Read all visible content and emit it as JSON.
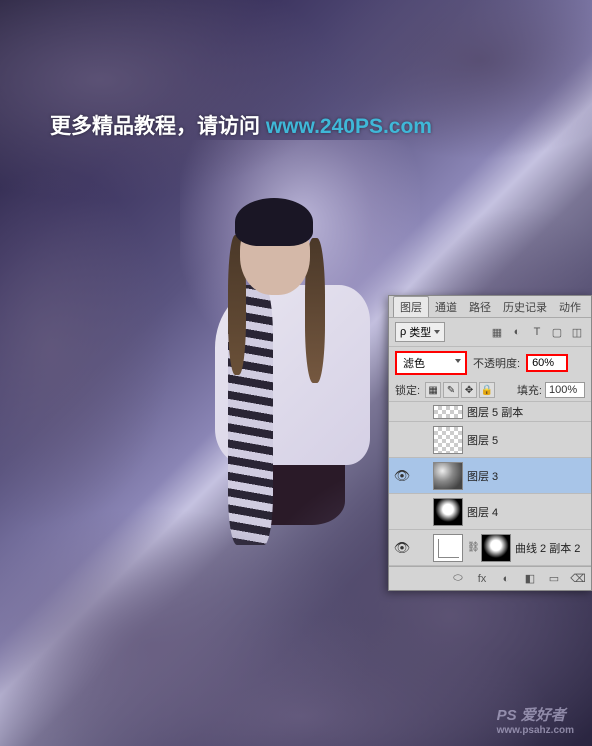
{
  "banner": {
    "text_prefix": "更多精品教程，请访问 ",
    "url": "www.240PS.com"
  },
  "watermark": {
    "logo": "PS 爱好者",
    "url": "www.psahz.com"
  },
  "panel": {
    "tabs": {
      "layers": "图层",
      "channels": "通道",
      "paths": "路径",
      "history": "历史记录",
      "actions": "动作"
    },
    "type_filter": {
      "search_icon": "ρ",
      "label": "类型",
      "icons": [
        "▦",
        "◐",
        "T",
        "▢",
        "◫"
      ]
    },
    "blend": {
      "mode": "滤色",
      "opacity_label": "不透明度:",
      "opacity_value": "60%"
    },
    "lock": {
      "label": "锁定:",
      "icons": [
        "▦",
        "✎",
        "✥",
        "🔒"
      ],
      "fill_label": "填充:",
      "fill_value": "100%"
    },
    "layers": [
      {
        "visible": false,
        "name": "图层 5 副本",
        "thumb": "hidden-partial",
        "partial": true
      },
      {
        "visible": false,
        "name": "图层 5",
        "thumb": "checker",
        "selected": false,
        "indent": true
      },
      {
        "visible": true,
        "name": "图层 3",
        "thumb": "cloud",
        "selected": true,
        "indent": true
      },
      {
        "visible": false,
        "name": "图层 4",
        "thumb": "mask",
        "selected": false,
        "indent": true
      },
      {
        "visible": true,
        "name": "曲线 2 副本 2",
        "thumb": "curve",
        "selected": false,
        "indent": true,
        "hasMask": true
      }
    ],
    "footer_icons": [
      "⬭",
      "fx",
      "◐",
      "◧",
      "▭",
      "⌫"
    ]
  }
}
